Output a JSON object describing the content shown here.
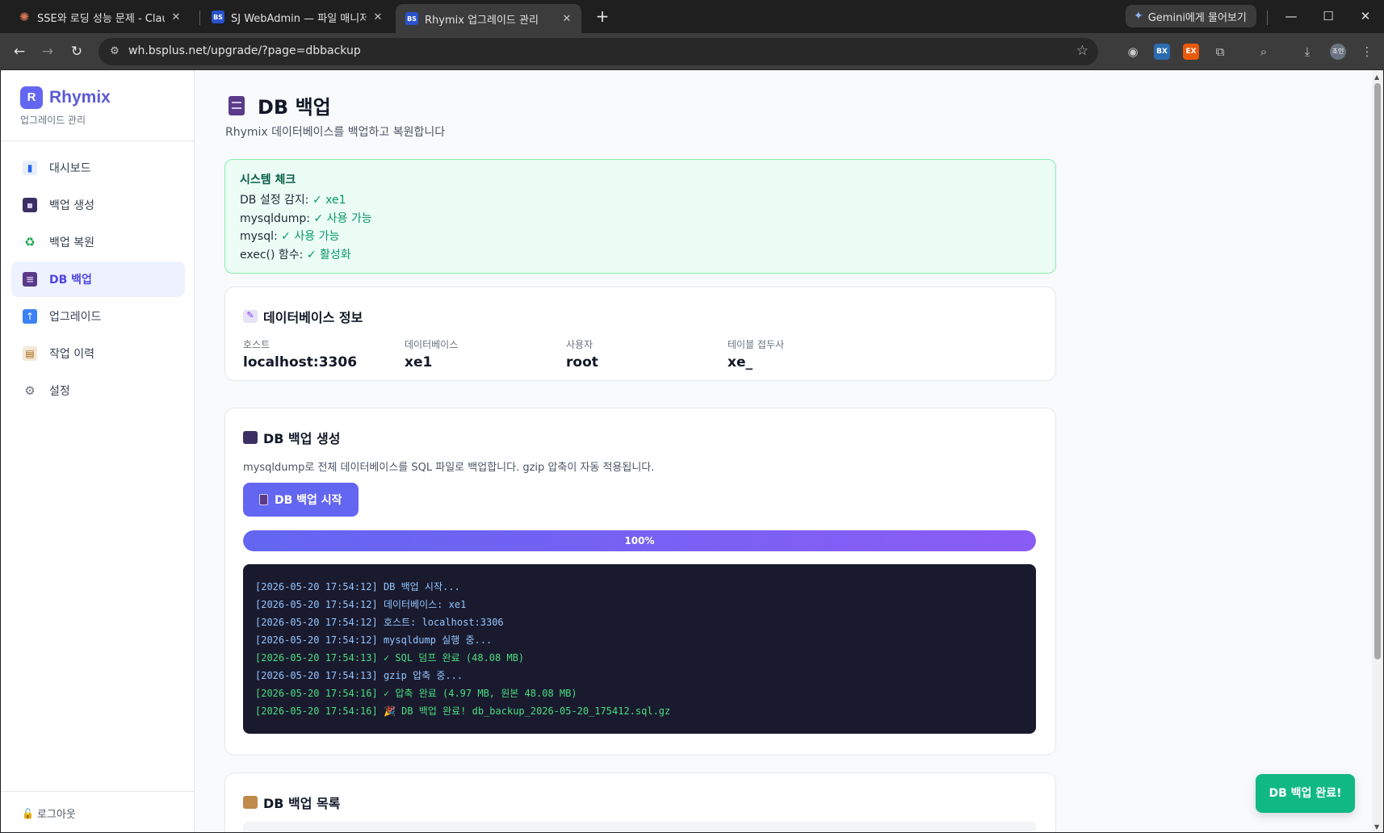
{
  "browser": {
    "tabs": [
      {
        "title": "SSE와 로딩 성능 문제 - Claude",
        "favicon": "claude-icon"
      },
      {
        "title": "SJ WebAdmin — 파일 매니저",
        "favicon": "BS"
      },
      {
        "title": "Rhymix 업그레이드 관리",
        "favicon": "BS"
      }
    ],
    "gemini_label": "Gemini에게 물어보기",
    "url": "wh.bsplus.net/upgrade/?page=dbbackup",
    "profile_initials": "초인",
    "extensions": [
      "BX",
      "EX"
    ]
  },
  "sidebar": {
    "logo_letter": "R",
    "brand": "Rhymix",
    "subtitle": "업그레이드 관리",
    "items": [
      {
        "label": "대시보드",
        "icon": "chart-icon",
        "active": false
      },
      {
        "label": "백업 생성",
        "icon": "floppy-icon",
        "active": false
      },
      {
        "label": "백업 복원",
        "icon": "recycle-icon",
        "active": false
      },
      {
        "label": "DB 백업",
        "icon": "database-icon",
        "active": true
      },
      {
        "label": "업그레이드",
        "icon": "up-arrow-icon",
        "active": false
      },
      {
        "label": "작업 이력",
        "icon": "clipboard-icon",
        "active": false
      },
      {
        "label": "설정",
        "icon": "gear-icon",
        "active": false
      }
    ],
    "logout": "로그아웃"
  },
  "page": {
    "title": "DB 백업",
    "subtitle": "Rhymix 데이터베이스를 백업하고 복원합니다"
  },
  "system_check": {
    "title": "시스템 체크",
    "lines": [
      {
        "label": "DB 설정 감지: ",
        "status": "✓ xe1"
      },
      {
        "label": "mysqldump: ",
        "status": "✓ 사용 가능"
      },
      {
        "label": "mysql: ",
        "status": "✓ 사용 가능"
      },
      {
        "label": "exec() 함수: ",
        "status": "✓ 활성화"
      }
    ]
  },
  "db_info": {
    "title": "데이터베이스 정보",
    "fields": [
      {
        "label": "호스트",
        "value": "localhost:3306"
      },
      {
        "label": "데이터베이스",
        "value": "xe1"
      },
      {
        "label": "사용자",
        "value": "root"
      },
      {
        "label": "테이블 접두사",
        "value": "xe_"
      }
    ]
  },
  "backup_create": {
    "title": "DB 백업 생성",
    "description": "mysqldump로 전체 데이터베이스를 SQL 파일로 백업합니다. gzip 압축이 자동 적용됩니다.",
    "button_label": "DB 백업 시작",
    "progress_label": "100%",
    "progress_value": 1.0,
    "logs": [
      {
        "text": "[2026-05-20 17:54:12] DB 백업 시작...",
        "type": "info"
      },
      {
        "text": "[2026-05-20 17:54:12] 데이터베이스: xe1",
        "type": "info"
      },
      {
        "text": "[2026-05-20 17:54:12] 호스트: localhost:3306",
        "type": "info"
      },
      {
        "text": "[2026-05-20 17:54:12] mysqldump 실행 중...",
        "type": "info"
      },
      {
        "text": "[2026-05-20 17:54:13] ✓ SQL 덤프 완료 (48.08 MB)",
        "type": "ok"
      },
      {
        "text": "[2026-05-20 17:54:13] gzip 압축 중...",
        "type": "info"
      },
      {
        "text": "[2026-05-20 17:54:16] ✓ 압축 완료 (4.97 MB, 원본 48.08 MB)",
        "type": "ok"
      },
      {
        "text": "[2026-05-20 17:54:16] 🎉 DB 백업 완료! db_backup_2026-05-20_175412.sql.gz",
        "type": "ok"
      }
    ]
  },
  "backup_list": {
    "title": "DB 백업 목록"
  },
  "toast": "DB 백업 완료!",
  "colors": {
    "accent": "#6366f1",
    "success": "#10b981",
    "console_bg": "#1a1a2e"
  }
}
